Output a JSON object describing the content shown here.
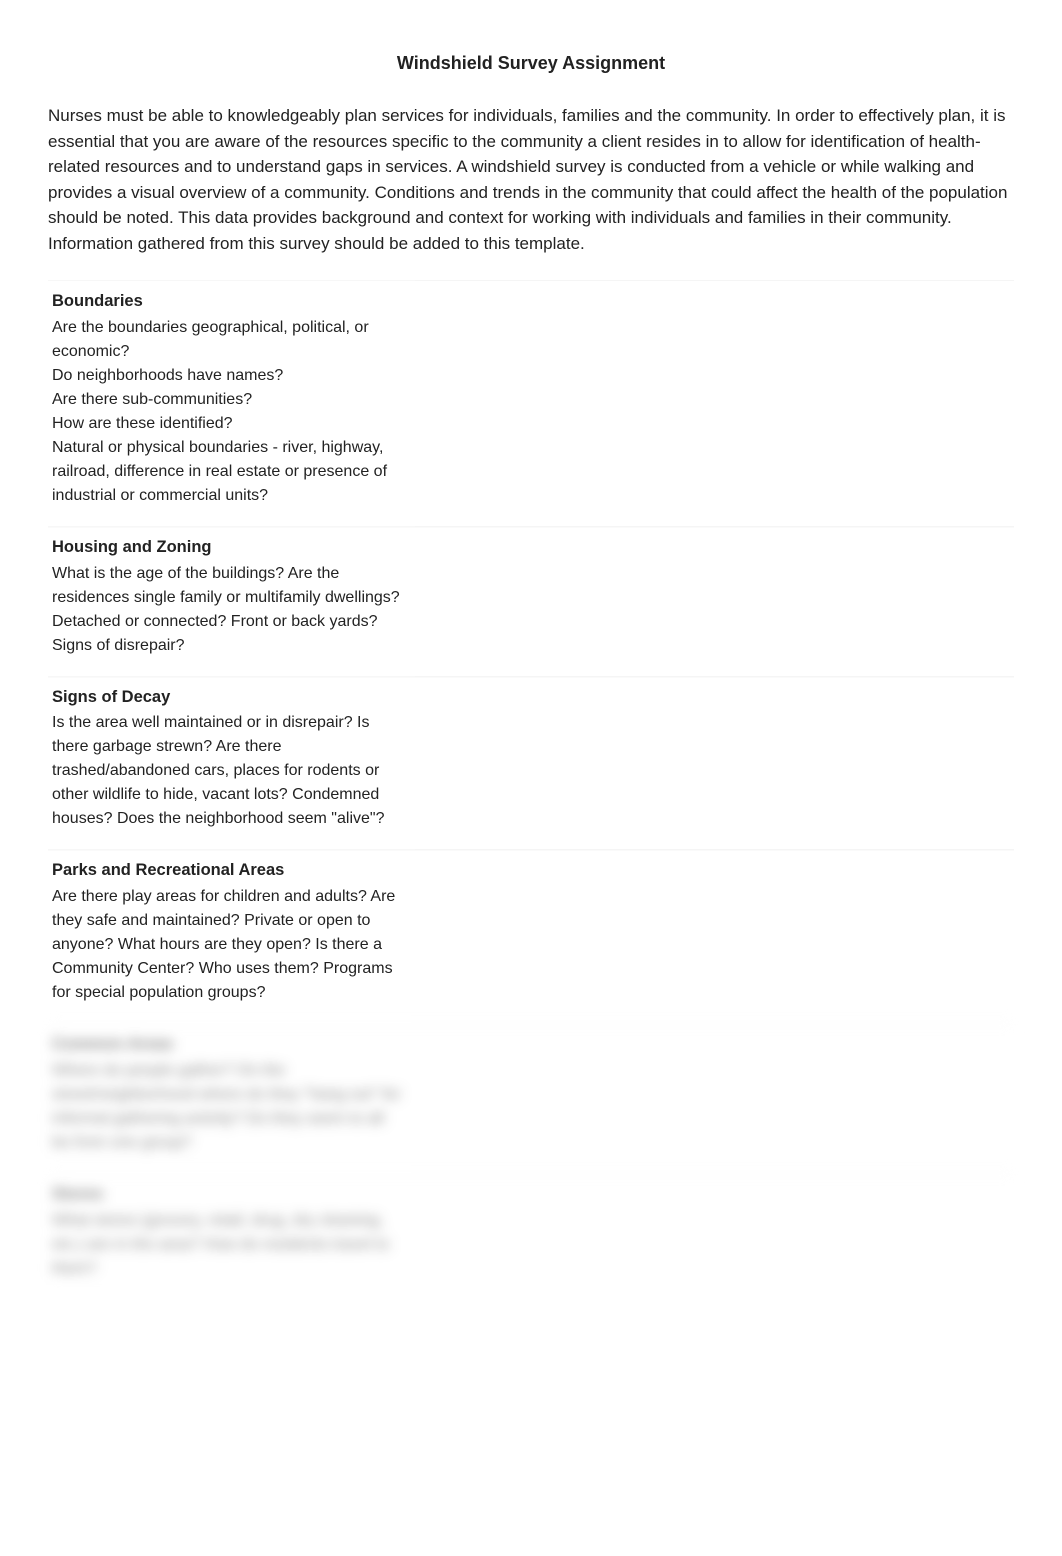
{
  "title": "Windshield Survey Assignment",
  "intro": "Nurses must be able to knowledgeably plan services for individuals, families and the community.  In order to effectively plan, it is essential that you are aware of the resources specific to the community a client resides in to allow for identification of health-related resources and to understand gaps in services. A windshield survey is conducted from a vehicle or while walking and provides a visual overview of a community. Conditions and trends in the community that could affect the health of the population should be noted. This data provides background and context for working with individuals and families in their community.  Information gathered from this survey should be added to this template.",
  "sections": [
    {
      "heading": "Boundaries",
      "body": "Are the boundaries geographical, political, or economic?\nDo neighborhoods have names?\nAre there sub-communities?\nHow are these identified?\nNatural or physical boundaries - river, highway, railroad, difference in real estate or presence of industrial or commercial units?",
      "response": "",
      "blurred": false
    },
    {
      "heading": "Housing and Zoning",
      "body": "What is the age of the buildings?  Are the residences single family or multifamily dwellings?  Detached or connected?  Front or back yards?  Signs of disrepair?",
      "response": "",
      "blurred": false
    },
    {
      "heading": "Signs of Decay",
      "body": "Is the area well maintained or in disrepair? Is there garbage strewn? Are there trashed/abandoned cars, places for rodents or other wildlife to hide, vacant lots? Condemned houses?  Does the neighborhood seem \"alive\"?",
      "response": "",
      "blurred": false
    },
    {
      "heading": "Parks and Recreational Areas",
      "body": "Are there play areas for children and adults? Are they safe and maintained?  Private or open to anyone?  What hours are they open? Is there a Community Center? Who uses them?  Programs for special population groups?",
      "response": "",
      "blurred": false
    },
    {
      "heading": "Common Areas",
      "body": "Where do people gather? On the street/neighborhood where do they \"hang out\" for informal gathering activity? Do they seem to all be from one group?",
      "response": "",
      "blurred": true
    },
    {
      "heading": "Stores",
      "body": "What stores (grocery, retail, drug, dry cleaning, etc.) are in the area? How do residents travel to them?",
      "response": "",
      "blurred": true
    }
  ]
}
